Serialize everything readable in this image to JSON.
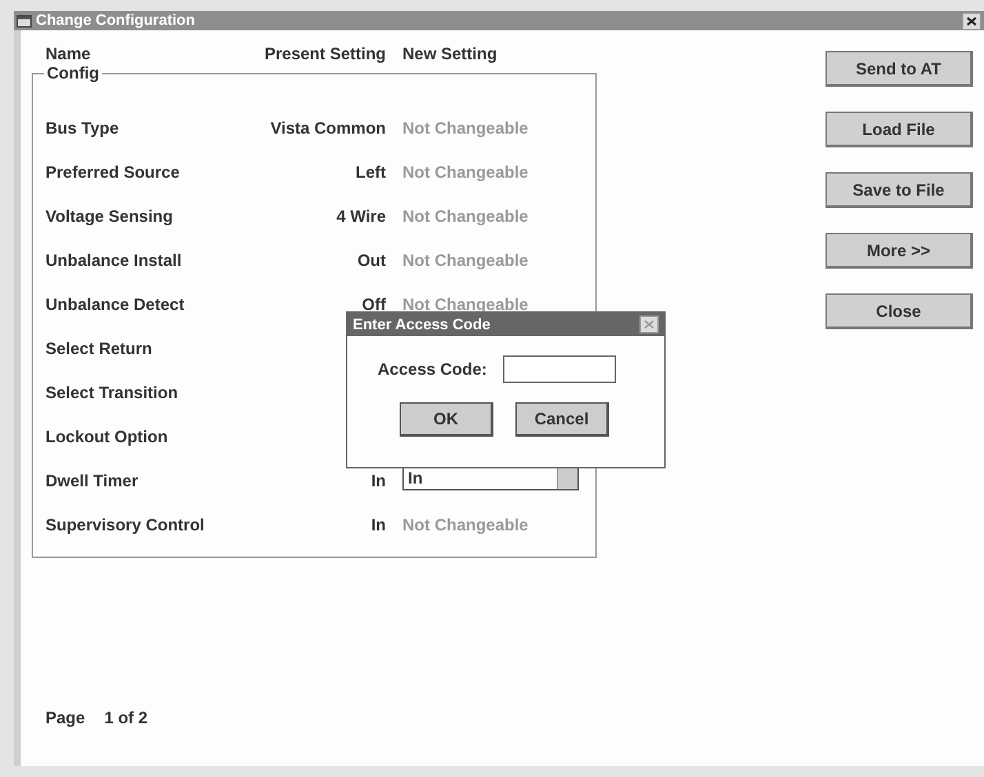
{
  "window": {
    "title": "Change Configuration"
  },
  "columns": [
    "Name",
    "Present Setting",
    "New Setting"
  ],
  "group": {
    "title": "Config"
  },
  "rows": [
    {
      "name": "Bus Type",
      "present": "Vista Common",
      "new": "Not Changeable",
      "kind": "fixed"
    },
    {
      "name": "Preferred Source",
      "present": "Left",
      "new": "Not Changeable",
      "kind": "fixed"
    },
    {
      "name": "Voltage Sensing",
      "present": "4 Wire",
      "new": "Not Changeable",
      "kind": "fixed"
    },
    {
      "name": "Unbalance Install",
      "present": "Out",
      "new": "Not Changeable",
      "kind": "fixed"
    },
    {
      "name": "Unbalance Detect",
      "present": "Off",
      "new": "Not Changeable",
      "kind": "fixed"
    },
    {
      "name": "Select Return",
      "kind": "hidden"
    },
    {
      "name": "Select Transition",
      "kind": "hidden"
    },
    {
      "name": "Lockout Option",
      "kind": "hidden"
    },
    {
      "name": "Dwell Timer",
      "present": "In",
      "new": "In",
      "kind": "dropdown"
    },
    {
      "name": "Supervisory Control",
      "present": "In",
      "new": "Not Changeable",
      "kind": "fixed"
    }
  ],
  "buttons": [
    "Send to AT",
    "Load File",
    "Save to File",
    "More >>",
    "Close"
  ],
  "page": {
    "label": "Page",
    "value": "1 of 2"
  },
  "dialog": {
    "title": "Enter Access Code",
    "label": "Access Code:",
    "buttons": [
      "OK",
      "Cancel"
    ]
  }
}
